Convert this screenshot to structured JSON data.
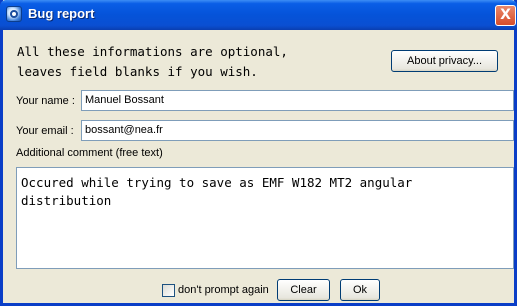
{
  "window": {
    "title": "Bug report",
    "close_symbol": "X"
  },
  "info": {
    "line1": "All these informations are optional,",
    "line2": "leaves field blanks if you wish."
  },
  "buttons": {
    "about_privacy": "About privacy...",
    "clear": "Clear",
    "ok": "Ok"
  },
  "form": {
    "name_label": "Your name :",
    "name_value": "Manuel Bossant",
    "email_label": "Your email :",
    "email_value": "bossant@nea.fr",
    "comment_label": "Additional comment (free text)",
    "comment_value": "Occured while trying to save as EMF W182 MT2 angular\ndistribution"
  },
  "dont_prompt": {
    "label": "don't prompt again",
    "checked": false
  },
  "colors": {
    "title_bar": "#0553d9",
    "dialog_bg": "#ece9d8",
    "field_border": "#7f9db9",
    "close_button": "#d74d2a"
  },
  "icons": {
    "title": "bug-report-app-icon",
    "close": "close-icon"
  }
}
